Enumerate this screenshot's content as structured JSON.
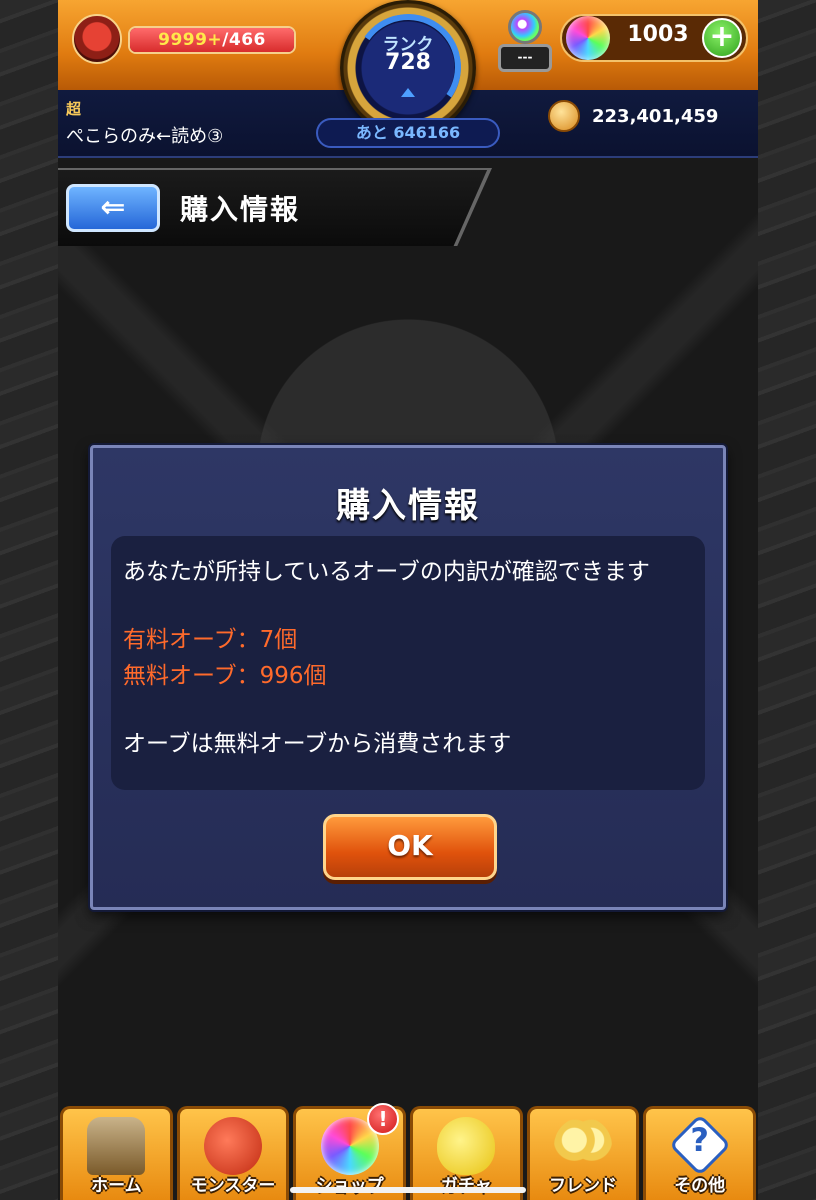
{
  "status": {
    "stamina_current": "9999+",
    "stamina_max": "/466",
    "stamina_fraction": 1.0,
    "rank_label": "ランク",
    "rank_value": "728",
    "rank_next": "あと 646166",
    "device_label": "---",
    "orb_count": "1003",
    "plus_label": "+",
    "user_rank_tag": "超",
    "user_name": "ぺこらのみ←読め③",
    "coin_count": "223,401,459"
  },
  "header": {
    "back_label": "⇐",
    "title": "購入情報"
  },
  "dialog": {
    "title": "購入情報",
    "description": "あなたが所持しているオーブの内訳が確認できます",
    "paid_orbs": "有料オーブ：7個",
    "free_orbs": "無料オーブ：996個",
    "note": "オーブは無料オーブから消費されます",
    "ok_label": "OK"
  },
  "nav": {
    "items": [
      {
        "label": "ホーム",
        "icon": "home-icon"
      },
      {
        "label": "モンスター",
        "icon": "monster-icon"
      },
      {
        "label": "ショップ",
        "icon": "shop-orb-icon",
        "badge": "!"
      },
      {
        "label": "ガチャ",
        "icon": "gacha-egg-icon"
      },
      {
        "label": "フレンド",
        "icon": "friend-icon"
      },
      {
        "label": "その他",
        "icon": "other-icon",
        "glyph": "?"
      }
    ]
  },
  "colors": {
    "accent_orange": "#e07b10",
    "dialog_bg": "#2e3765",
    "highlight_text": "#ff6a2b"
  }
}
